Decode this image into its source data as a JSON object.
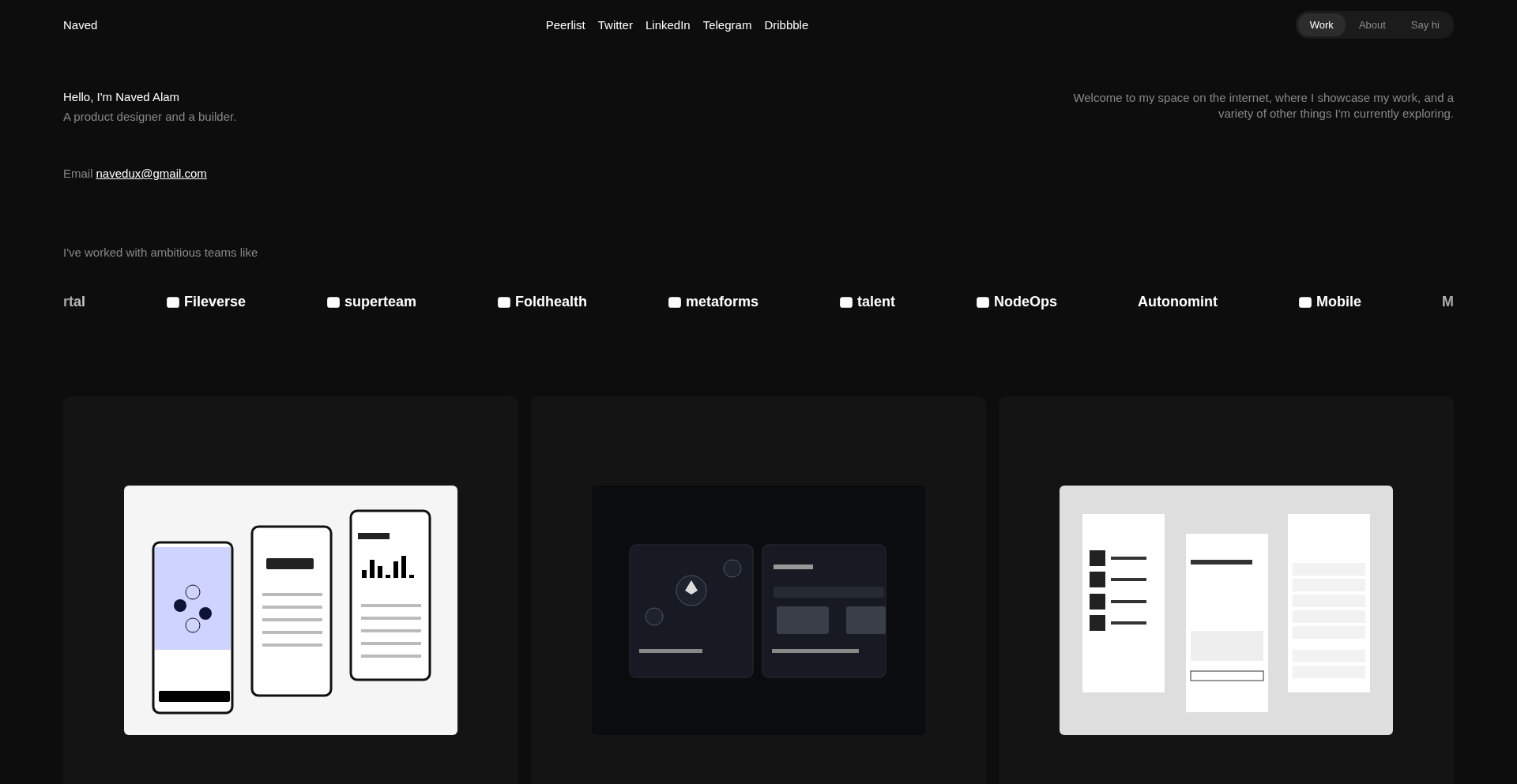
{
  "header": {
    "name": "Naved",
    "links": [
      "Peerlist",
      "Twitter",
      "LinkedIn",
      "Telegram",
      "Dribbble"
    ],
    "tabs": [
      {
        "label": "Work",
        "selected": true
      },
      {
        "label": "About",
        "selected": false
      },
      {
        "label": "Say hi",
        "selected": false
      }
    ]
  },
  "intro": {
    "greeting": "Hello, I'm Naved Alam",
    "tagline": "A product designer and a builder.",
    "welcome": "Welcome to my space on the internet, where I showcase my work, and a variety of other things I'm currently exploring.",
    "email_label": "Email",
    "email": "navedux@gmail.com"
  },
  "teams": {
    "heading": "I've worked with ambitious teams like",
    "logos": [
      {
        "name": "rtal",
        "icon": false
      },
      {
        "name": "Fileverse",
        "icon": true
      },
      {
        "name": "superteam",
        "icon": true
      },
      {
        "name": "Foldhealth",
        "icon": true
      },
      {
        "name": "metaforms",
        "icon": true
      },
      {
        "name": "talent",
        "icon": true
      },
      {
        "name": "NodeOps",
        "icon": true
      },
      {
        "name": "Autonomint",
        "icon": false
      },
      {
        "name": "Mobile",
        "icon": true
      },
      {
        "name": "M",
        "icon": false
      }
    ]
  },
  "projects": [
    {
      "kind": "finance"
    },
    {
      "kind": "crypto"
    },
    {
      "kind": "orders"
    }
  ]
}
